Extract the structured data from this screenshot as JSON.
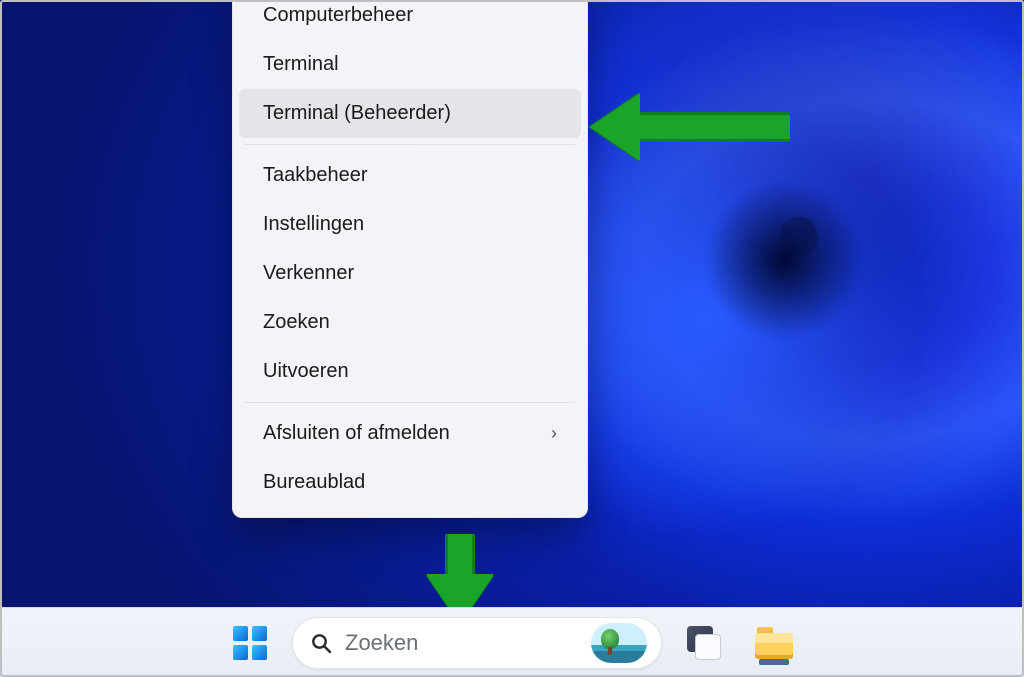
{
  "menu": {
    "items": [
      {
        "label": "Computerbeheer",
        "highlighted": false,
        "submenu": false
      },
      {
        "label": "Terminal",
        "highlighted": false,
        "submenu": false
      },
      {
        "label": "Terminal (Beheerder)",
        "highlighted": true,
        "submenu": false
      },
      {
        "separator": true
      },
      {
        "label": "Taakbeheer",
        "highlighted": false,
        "submenu": false
      },
      {
        "label": "Instellingen",
        "highlighted": false,
        "submenu": false
      },
      {
        "label": "Verkenner",
        "highlighted": false,
        "submenu": false
      },
      {
        "label": "Zoeken",
        "highlighted": false,
        "submenu": false
      },
      {
        "label": "Uitvoeren",
        "highlighted": false,
        "submenu": false
      },
      {
        "separator": true
      },
      {
        "label": "Afsluiten of afmelden",
        "highlighted": false,
        "submenu": true
      },
      {
        "label": "Bureaublad",
        "highlighted": false,
        "submenu": false
      }
    ]
  },
  "taskbar": {
    "search_placeholder": "Zoeken"
  }
}
